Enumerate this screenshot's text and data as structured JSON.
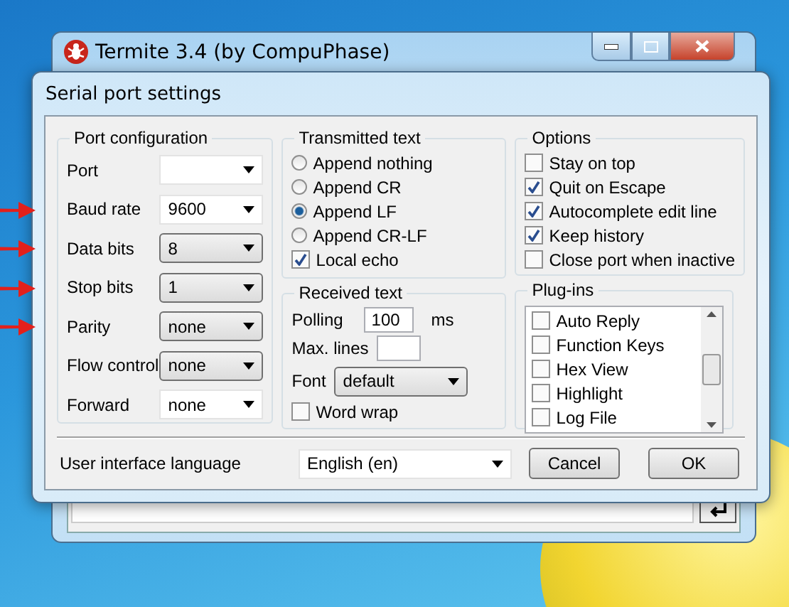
{
  "main_window": {
    "title": "Termite 3.4 (by CompuPhase)"
  },
  "dialog": {
    "title": "Serial port settings",
    "port_configuration": {
      "title": "Port configuration",
      "fields": [
        {
          "label": "Port",
          "kind": "edit",
          "marked": false
        },
        {
          "label": "Baud rate",
          "value": "9600",
          "kind": "edit",
          "marked": true
        },
        {
          "label": "Data bits",
          "value": "8",
          "kind": "list",
          "marked": true
        },
        {
          "label": "Stop bits",
          "value": "1",
          "kind": "list",
          "marked": true
        },
        {
          "label": "Parity",
          "value": "none",
          "kind": "list",
          "marked": true
        },
        {
          "label": "Flow control",
          "value": "none",
          "kind": "list",
          "marked": false
        },
        {
          "label": "Forward",
          "value": "none",
          "kind": "edit",
          "marked": false
        }
      ]
    },
    "transmitted_text": {
      "title": "Transmitted text",
      "options": [
        {
          "label": "Append nothing",
          "selected": false
        },
        {
          "label": "Append CR",
          "selected": false
        },
        {
          "label": "Append LF",
          "selected": true
        },
        {
          "label": "Append CR-LF",
          "selected": false
        }
      ],
      "local_echo": {
        "label": "Local echo",
        "checked": true
      }
    },
    "received_text": {
      "title": "Received text",
      "polling": {
        "label": "Polling",
        "value": "100",
        "unit": "ms"
      },
      "max_lines": {
        "label": "Max. lines"
      },
      "font": {
        "label": "Font",
        "value": "default"
      },
      "word_wrap": {
        "label": "Word wrap",
        "checked": false
      }
    },
    "options": {
      "title": "Options",
      "items": [
        {
          "label": "Stay on top",
          "checked": false
        },
        {
          "label": "Quit on Escape",
          "checked": true
        },
        {
          "label": "Autocomplete edit line",
          "checked": true
        },
        {
          "label": "Keep history",
          "checked": true
        },
        {
          "label": "Close port when inactive",
          "checked": false
        }
      ]
    },
    "plugins": {
      "title": "Plug-ins",
      "items": [
        {
          "label": "Auto Reply",
          "checked": false
        },
        {
          "label": "Function Keys",
          "checked": false
        },
        {
          "label": "Hex View",
          "checked": false
        },
        {
          "label": "Highlight",
          "checked": false
        },
        {
          "label": "Log File",
          "checked": false
        }
      ]
    },
    "language": {
      "label": "User interface language",
      "value": "English (en)"
    },
    "buttons": [
      "Cancel",
      "OK"
    ]
  }
}
